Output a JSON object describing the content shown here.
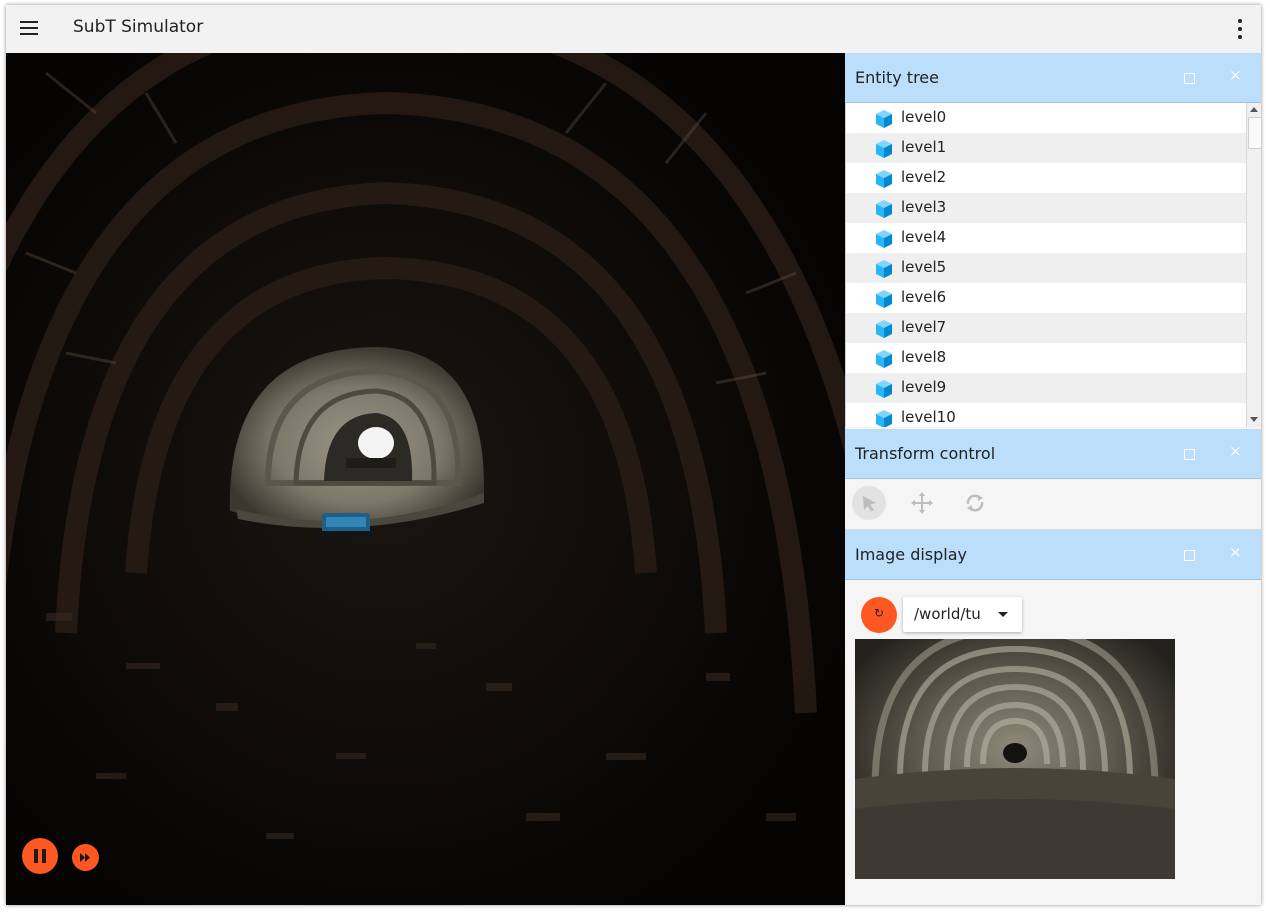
{
  "app": {
    "title": "SubT Simulator"
  },
  "icons": {
    "menu": "menu-icon",
    "more": "more-vert-icon",
    "pause": "pause-icon",
    "step": "fast-forward-icon",
    "entity": "cube-icon",
    "select": "select-arrow-icon",
    "translate": "move-icon",
    "rotate": "rotate-icon",
    "refresh": "refresh-icon",
    "dropdown": "caret-down-icon",
    "maximize": "maximize-icon",
    "close": "close-icon"
  },
  "colors": {
    "accent": "#ff5722",
    "panel_header": "#bbdefb",
    "entity_cube": "#29b6f6"
  },
  "entity_tree": {
    "title": "Entity tree",
    "close_glyph": "×",
    "items": [
      "level0",
      "level1",
      "level2",
      "level3",
      "level4",
      "level5",
      "level6",
      "level7",
      "level8",
      "level9",
      "level10"
    ]
  },
  "transform_control": {
    "title": "Transform control",
    "close_glyph": "×",
    "active_tool": "select"
  },
  "image_display": {
    "title": "Image display",
    "close_glyph": "×",
    "refresh_glyph": "↻",
    "topic_value": "/world/tu"
  }
}
